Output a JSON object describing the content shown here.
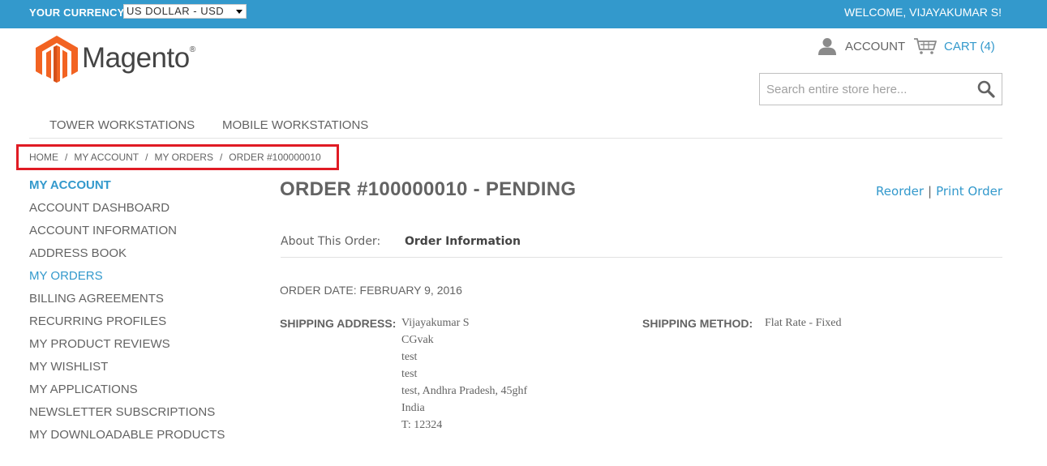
{
  "header": {
    "currency_label": "YOUR CURRENCY:",
    "currency_selected": "US DOLLAR - USD",
    "welcome": "WELCOME, VIJAYAKUMAR S!",
    "logo_text": "Magento",
    "logo_reg": "®",
    "account_label": "ACCOUNT",
    "cart_label": "CART (4)",
    "search_placeholder": "Search entire store here..."
  },
  "nav": {
    "items": [
      "TOWER WORKSTATIONS",
      "MOBILE WORKSTATIONS"
    ]
  },
  "breadcrumb": {
    "items": [
      "HOME",
      "MY ACCOUNT",
      "MY ORDERS",
      "ORDER #100000010"
    ],
    "separator": "/"
  },
  "sidebar": {
    "title": "MY ACCOUNT",
    "items": [
      "ACCOUNT DASHBOARD",
      "ACCOUNT INFORMATION",
      "ADDRESS BOOK",
      "MY ORDERS",
      "BILLING AGREEMENTS",
      "RECURRING PROFILES",
      "MY PRODUCT REVIEWS",
      "MY WISHLIST",
      "MY APPLICATIONS",
      "NEWSLETTER SUBSCRIPTIONS",
      "MY DOWNLOADABLE PRODUCTS"
    ],
    "active_item": "MY ORDERS"
  },
  "order": {
    "title": "ORDER #100000010 - PENDING",
    "reorder_label": "Reorder",
    "link_separator": "|",
    "print_label": "Print Order",
    "about_label": "About This Order:",
    "info_tab_label": "Order Information",
    "order_date": "ORDER DATE: FEBRUARY 9, 2016",
    "shipping_address_label": "SHIPPING ADDRESS:",
    "shipping_address_lines": [
      "Vijayakumar S",
      "CGvak",
      "test",
      "test",
      "test, Andhra Pradesh, 45ghf",
      "India",
      "T: 12324"
    ],
    "shipping_method_label": "SHIPPING METHOD:",
    "shipping_method": "Flat Rate - Fixed"
  },
  "colors": {
    "accent": "#3399cc",
    "highlight_box": "#e01b24",
    "logo_orange": "#f26322",
    "text": "#636363"
  }
}
